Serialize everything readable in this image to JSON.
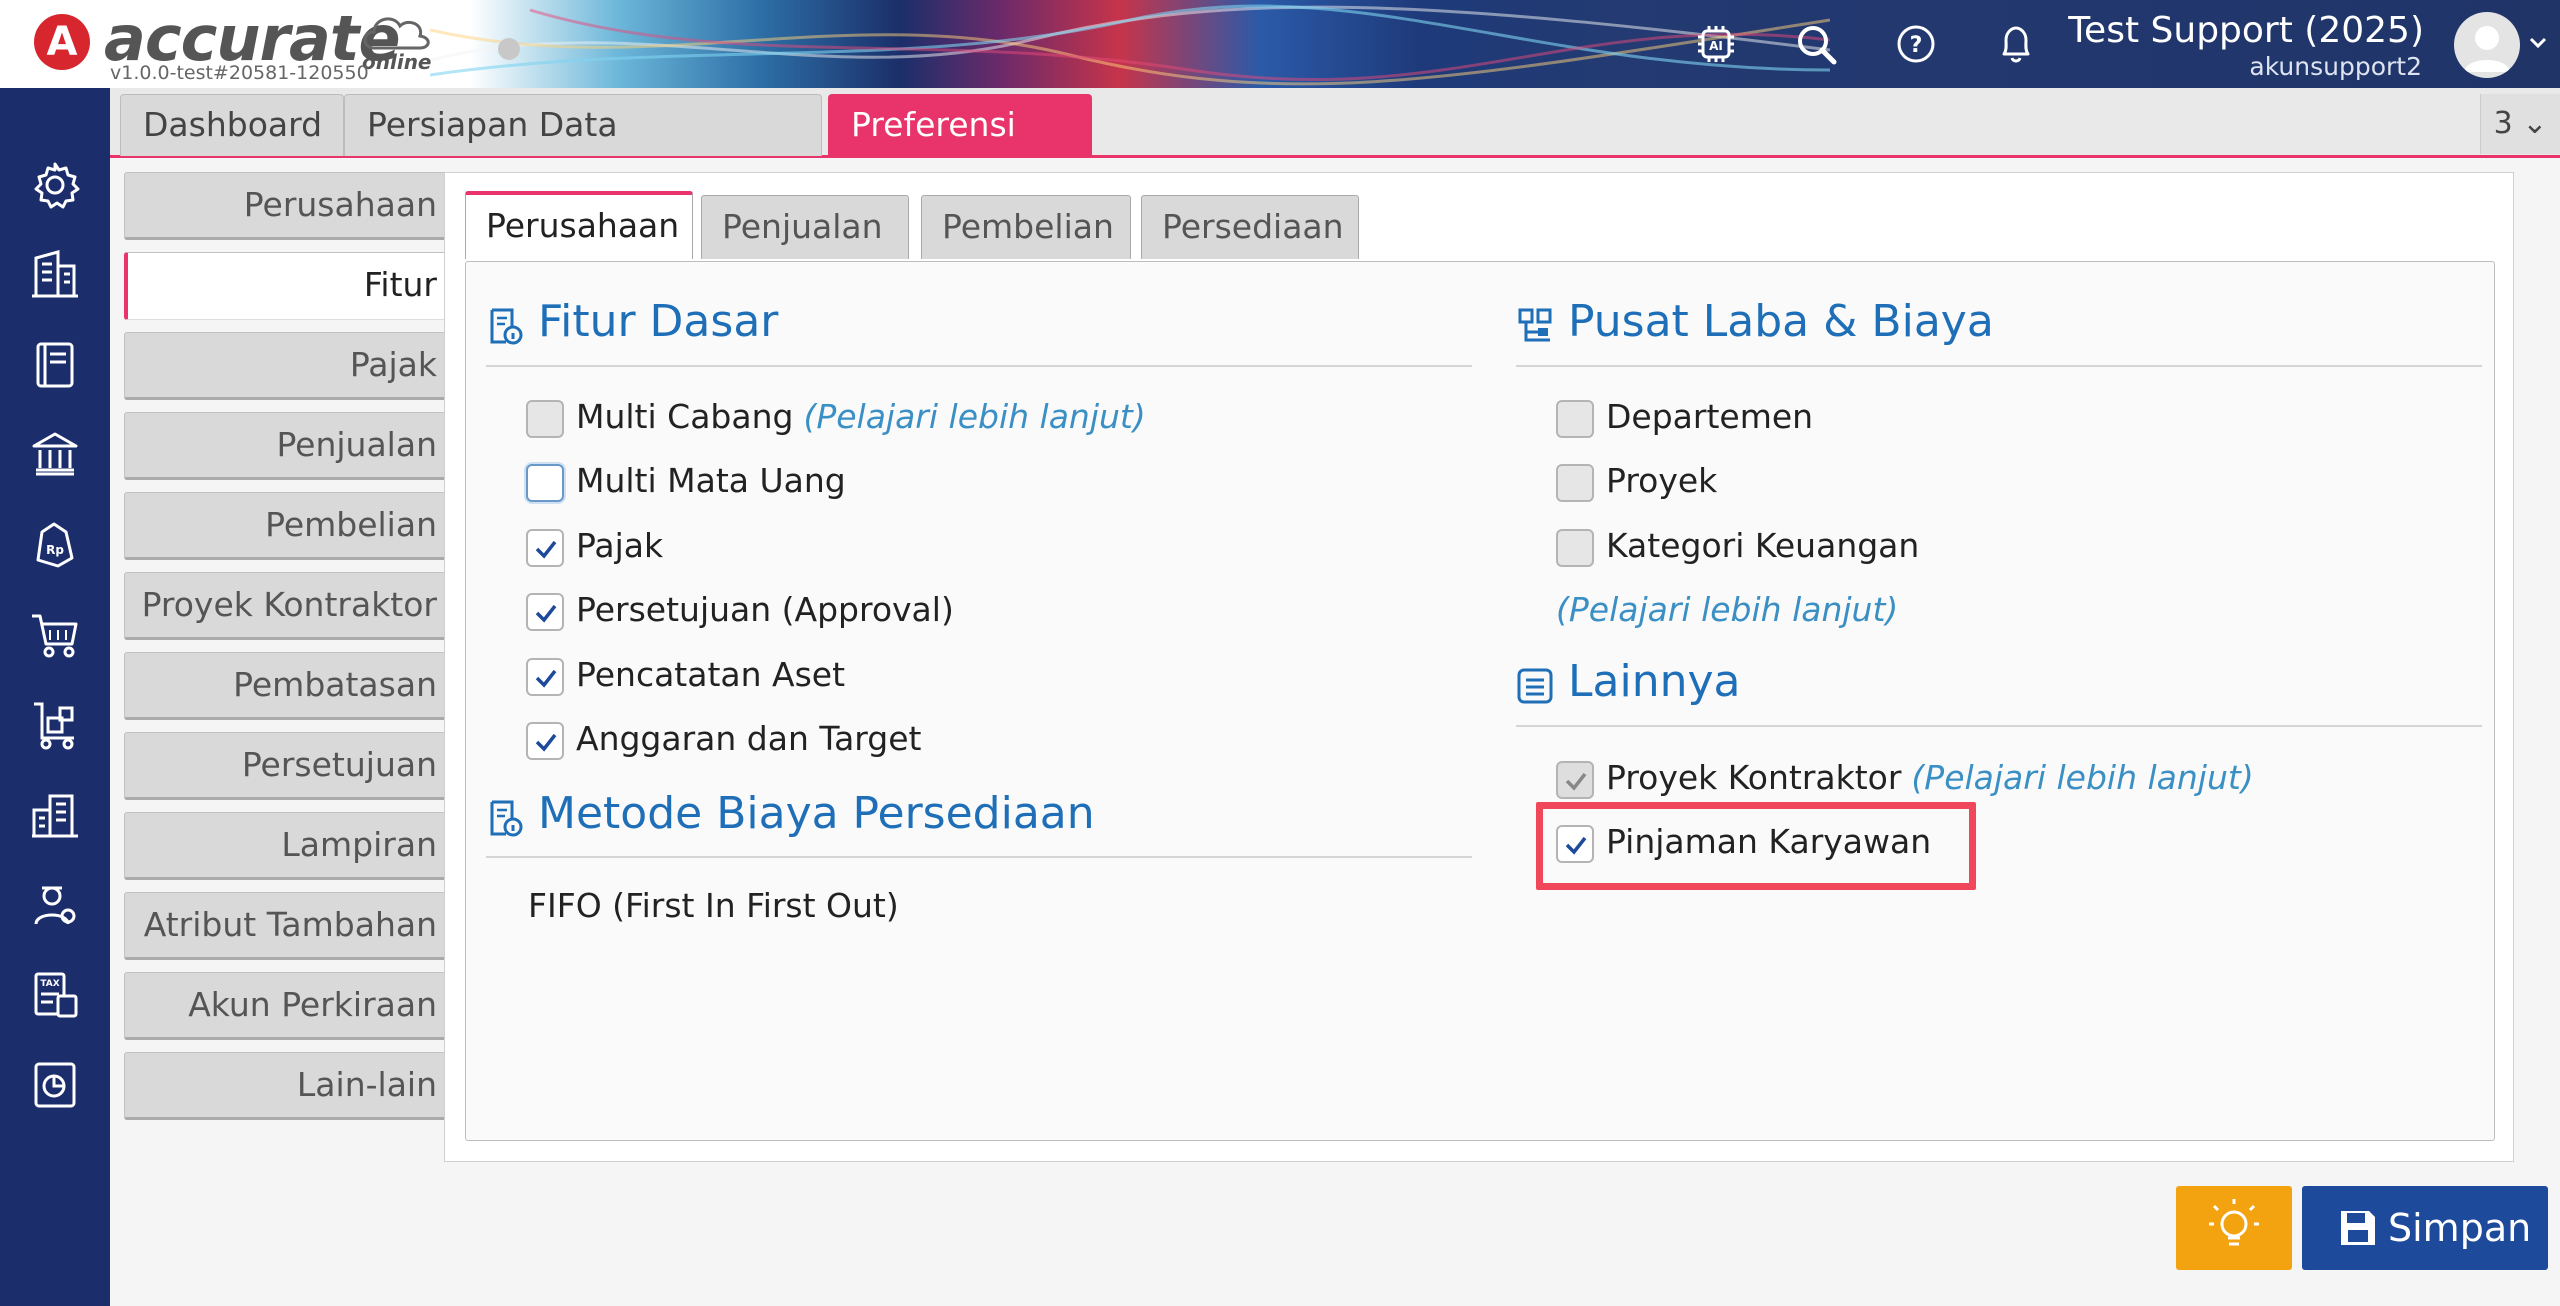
{
  "app": {
    "logo_mark": "A",
    "logo_text": "accurate",
    "logo_sub": "online",
    "version": "v1.0.0-test#20581-120550"
  },
  "header": {
    "user_name": "Test Support (2025)",
    "user_sub": "akunsupport2",
    "icons": [
      "ai-chip-icon",
      "search-icon",
      "help-icon",
      "bell-icon"
    ]
  },
  "tabs": {
    "items": [
      "Dashboard",
      "Persiapan Data Perusahaan",
      "Preferensi"
    ],
    "close_label": "✕",
    "counter": "3 ⌄"
  },
  "menu": {
    "items": [
      "Perusahaan",
      "Fitur",
      "Pajak",
      "Penjualan",
      "Pembelian",
      "Proyek Kontraktor",
      "Pembatasan",
      "Persetujuan",
      "Lampiran",
      "Atribut Tambahan",
      "Akun Perkiraan",
      "Lain-lain"
    ],
    "active": "Fitur"
  },
  "inner_tabs": {
    "items": [
      "Perusahaan",
      "Penjualan",
      "Pembelian",
      "Persediaan"
    ],
    "active": "Perusahaan"
  },
  "fitur_dasar": {
    "title": "Fitur Dasar",
    "items": [
      {
        "label": "Multi Cabang",
        "learn": "(Pelajari lebih lanjut)",
        "checked": false
      },
      {
        "label": "Multi Mata Uang",
        "checked": false
      },
      {
        "label": "Pajak",
        "checked": true
      },
      {
        "label": "Persetujuan (Approval)",
        "checked": true
      },
      {
        "label": "Pencatatan Aset",
        "checked": true
      },
      {
        "label": "Anggaran dan Target",
        "checked": true
      }
    ]
  },
  "metode": {
    "title": "Metode Biaya Persediaan",
    "value": "FIFO (First In First Out)"
  },
  "pusat_laba": {
    "title": "Pusat Laba & Biaya",
    "items": [
      {
        "label": "Departemen",
        "checked": false
      },
      {
        "label": "Proyek",
        "checked": false
      },
      {
        "label": "Kategori Keuangan",
        "checked": false
      }
    ],
    "learn": "(Pelajari lebih lanjut)"
  },
  "lainnya": {
    "title": "Lainnya",
    "items": [
      {
        "label": "Proyek Kontraktor",
        "learn": "(Pelajari lebih lanjut)",
        "checked": true
      },
      {
        "label": "Pinjaman Karyawan",
        "checked": true
      }
    ]
  },
  "buttons": {
    "save": "Simpan"
  },
  "colors": {
    "accent": "#e8336b",
    "sidebar": "#1c2d6b",
    "link": "#3a8fc4",
    "section": "#1e6fb8",
    "save": "#1e4a9c",
    "tip": "#f2a30f",
    "highlight": "#f0485a"
  }
}
